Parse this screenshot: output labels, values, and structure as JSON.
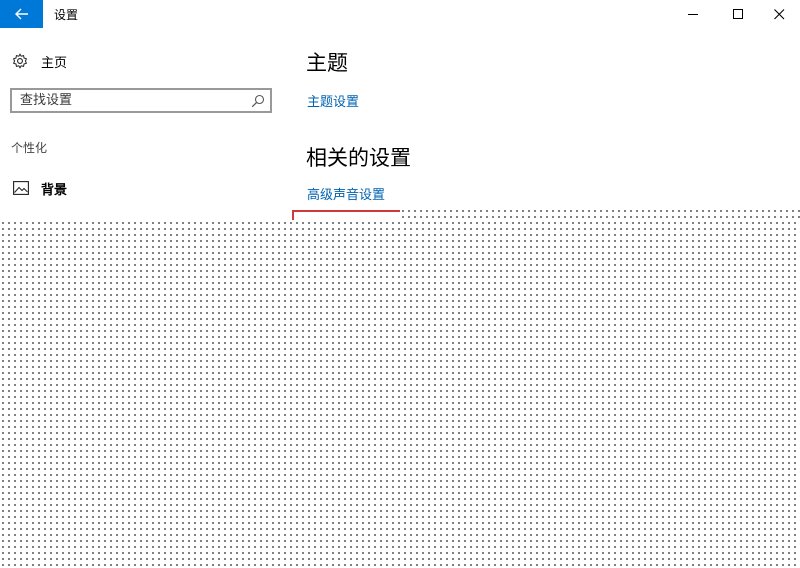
{
  "window": {
    "title": "设置",
    "accent_color": "#0078d7"
  },
  "nav": {
    "home_label": "主页",
    "search": {
      "placeholder": "查找设置",
      "value": ""
    },
    "section_label": "个性化",
    "items": [
      {
        "label": "背景",
        "icon": "picture-icon"
      }
    ]
  },
  "content": {
    "theme_heading": "主题",
    "theme_settings_link": "主题设置",
    "related_heading": "相关的设置",
    "advanced_sound_link": "高级声音设置"
  },
  "link_color": "#0063b1",
  "highlight_color": "#d03a3a"
}
